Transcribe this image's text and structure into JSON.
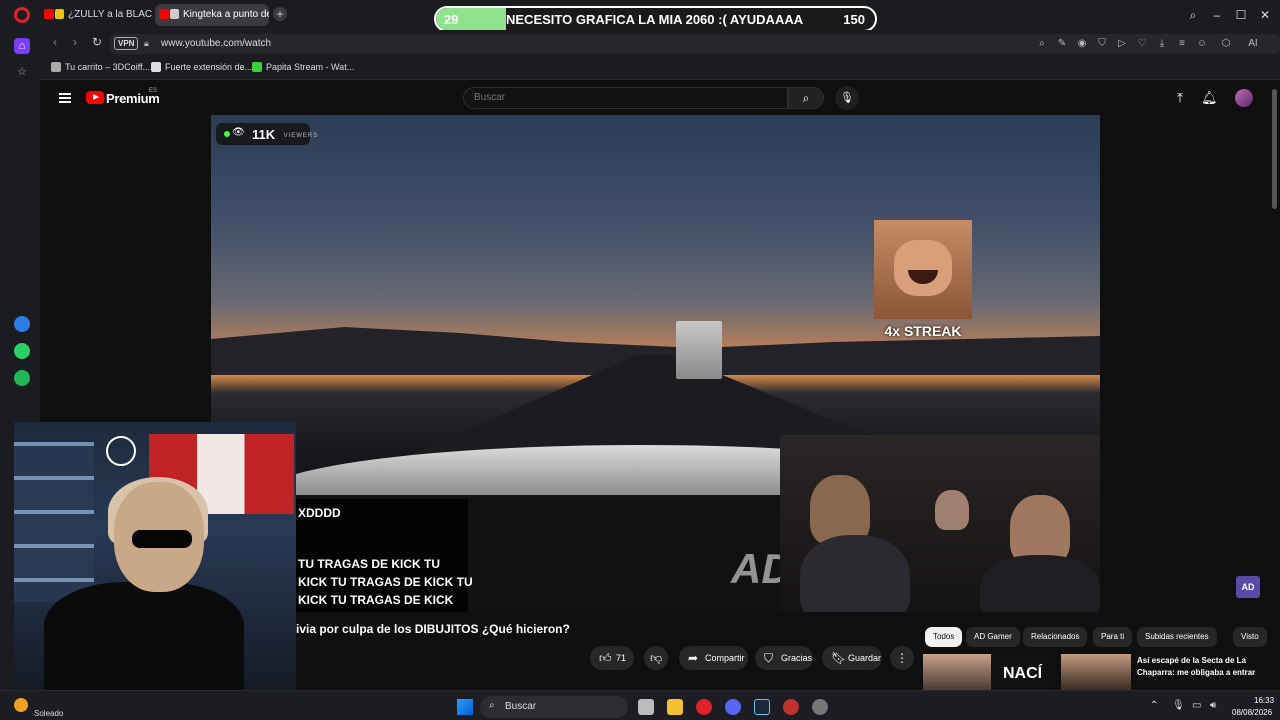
{
  "browser": {
    "tabs": [
      {
        "title": "¿ZULLY a la BLACKLIST",
        "active": false
      },
      {
        "title": "Kingteka a punto de C",
        "active": true
      }
    ],
    "new_tab_icon": "+",
    "address": {
      "vpn": "VPN",
      "url": "www.youtube.com/watch"
    },
    "window_controls": {
      "search": "search-icon",
      "minimize": "–",
      "maximize": "☐",
      "close": "✕"
    },
    "toolbar_ai_label": "AI",
    "bookmarks": [
      {
        "label": "Tu carrito – 3DCoiff..."
      },
      {
        "label": "Fuerte extensión de..."
      },
      {
        "label": "Papita Stream - Wat..."
      }
    ]
  },
  "poll": {
    "left_count": "29",
    "question": "NECESITO GRAFICA LA MIA 2060 :( AYUDAAAA",
    "right_count": "150",
    "left_fraction": 0.16,
    "fill_color": "#8fe38d"
  },
  "youtube": {
    "logo_text": "Premium",
    "region": "ES",
    "search_placeholder": "Buscar",
    "viewers": {
      "count": "11K",
      "label": "VIEWERS"
    },
    "streak_label": "4x STREAK",
    "chat_lines": [
      "XDDDD",
      "TU TRAGAS DE KICK TU",
      "KICK TU TRAGAS DE KICK TU",
      "KICK TU TRAGAS DE KICK"
    ],
    "video_watermark": "AD",
    "corner_logo": "AD",
    "video_title": "ivia por culpa de los DIBUJITOS ¿Qué hicieron?",
    "actions": {
      "like_count": "71",
      "share": "Compartir",
      "thanks": "Gracias",
      "save": "Guardar",
      "more": "⋮"
    },
    "chips": [
      "Todos",
      "AD Gamer",
      "Relacionados",
      "Para ti",
      "Subidas recientes",
      "Visto"
    ],
    "recommendation": {
      "thumb_text": "NACÍ",
      "title": "Así escapé de la Secta de La Chaparra: me obligaba a entrar"
    }
  },
  "taskbar": {
    "weather": "Soleado",
    "search_label": "Buscar",
    "time": "16:33",
    "date": "08/08/2026"
  },
  "colors": {
    "opera_red": "#e0202c",
    "youtube_red": "#ff0000",
    "poll_green": "#8fe38d"
  }
}
